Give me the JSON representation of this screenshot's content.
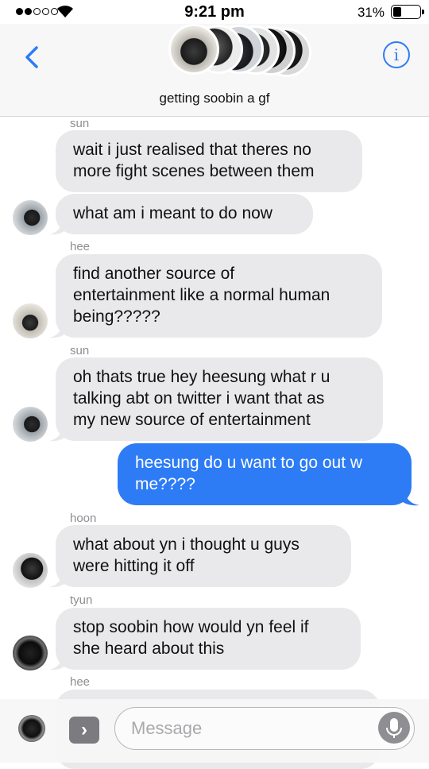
{
  "status_bar": {
    "time": "9:21 pm",
    "battery": "31%",
    "signal_dots_filled": 2,
    "signal_dots_total": 5
  },
  "header": {
    "group_name": "getting soobin a gf",
    "back_icon": "chevron-left-icon",
    "info_icon": "info-icon",
    "accent": "#2d7cf6"
  },
  "messages": [
    {
      "sender": "sun",
      "lines": [
        "wait i just realised that theres no",
        "more fight scenes between them"
      ]
    },
    {
      "lines": [
        "what am i meant to do now"
      ]
    },
    {
      "sender": "hee",
      "lines": [
        "find another source of",
        "entertainment like a normal human",
        "being?????"
      ]
    },
    {
      "sender": "sun",
      "lines": [
        "oh thats true hey heesung what r u",
        "talking abt on twitter i want that as",
        "my new source of entertainment"
      ]
    },
    {
      "lines": [
        "heesung do u want to go out w",
        "me????"
      ]
    },
    {
      "sender": "hoon",
      "lines": [
        "what about yn i thought u guys",
        "were hitting it off"
      ]
    },
    {
      "sender": "tyun",
      "lines": [
        "stop soobin how would yn feel if",
        "she heard about this"
      ]
    },
    {
      "sender": "hee"
    }
  ],
  "input": {
    "placeholder": "Message",
    "camera_icon": "camera-icon",
    "apps_icon": "apps-chevron-icon",
    "mic_icon": "microphone-icon"
  },
  "colors": {
    "incoming": "#e9e9eb",
    "outgoing": "#2d7cf6"
  }
}
